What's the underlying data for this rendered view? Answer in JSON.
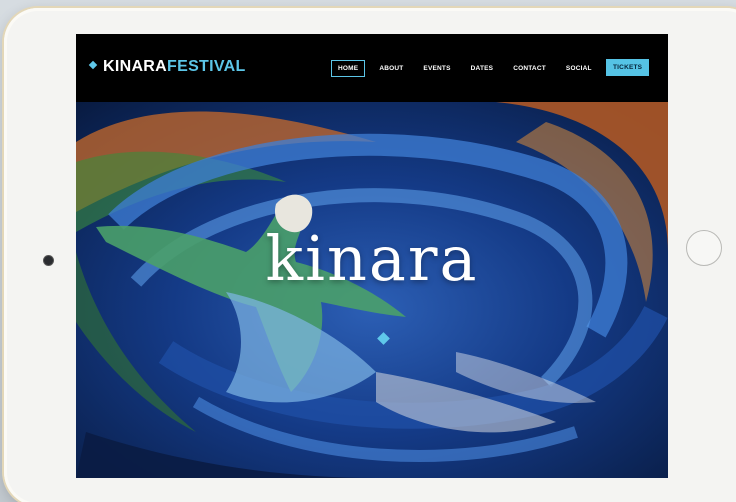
{
  "site": {
    "brand_part1": "KINARA",
    "brand_part2": "FESTIVAL",
    "hero_logo_text": "kinara"
  },
  "nav": {
    "items": [
      "HOME",
      "ABOUT",
      "EVENTS",
      "DATES",
      "CONTACT",
      "SOCIAL"
    ],
    "active": "HOME",
    "cta_label": "TICKETS"
  },
  "colors": {
    "accent": "#5cc6e8",
    "navbar_bg": "#000000",
    "tablet_frame": "#f4f4f2"
  },
  "icons": {
    "brand": "diamond-icon",
    "hero": "diamond-icon"
  }
}
